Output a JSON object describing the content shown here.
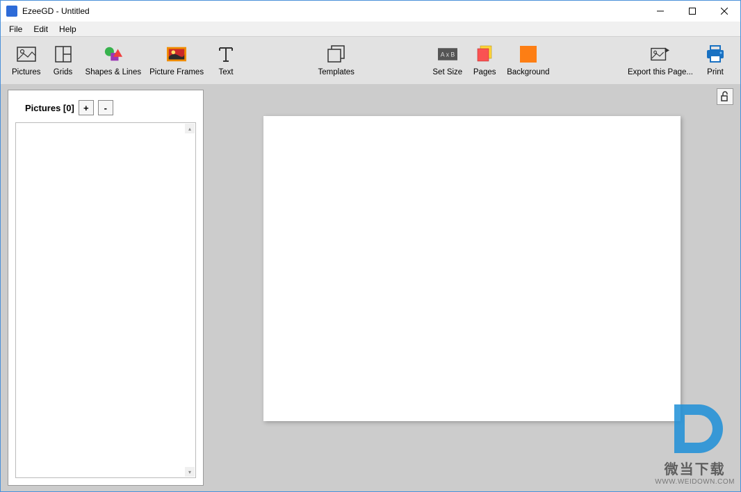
{
  "window": {
    "title": "EzeeGD - Untitled"
  },
  "menu": {
    "file": "File",
    "edit": "Edit",
    "help": "Help"
  },
  "toolbar": {
    "pictures": "Pictures",
    "grids": "Grids",
    "shapes": "Shapes & Lines",
    "frames": "Picture Frames",
    "text": "Text",
    "templates": "Templates",
    "setsize": "Set Size",
    "pages": "Pages",
    "background": "Background",
    "export": "Export this Page...",
    "print": "Print"
  },
  "panel": {
    "title": "Pictures [0]",
    "add": "+",
    "remove": "-"
  },
  "watermark": {
    "text": "微当下载",
    "url": "WWW.WEIDOWN.COM"
  }
}
